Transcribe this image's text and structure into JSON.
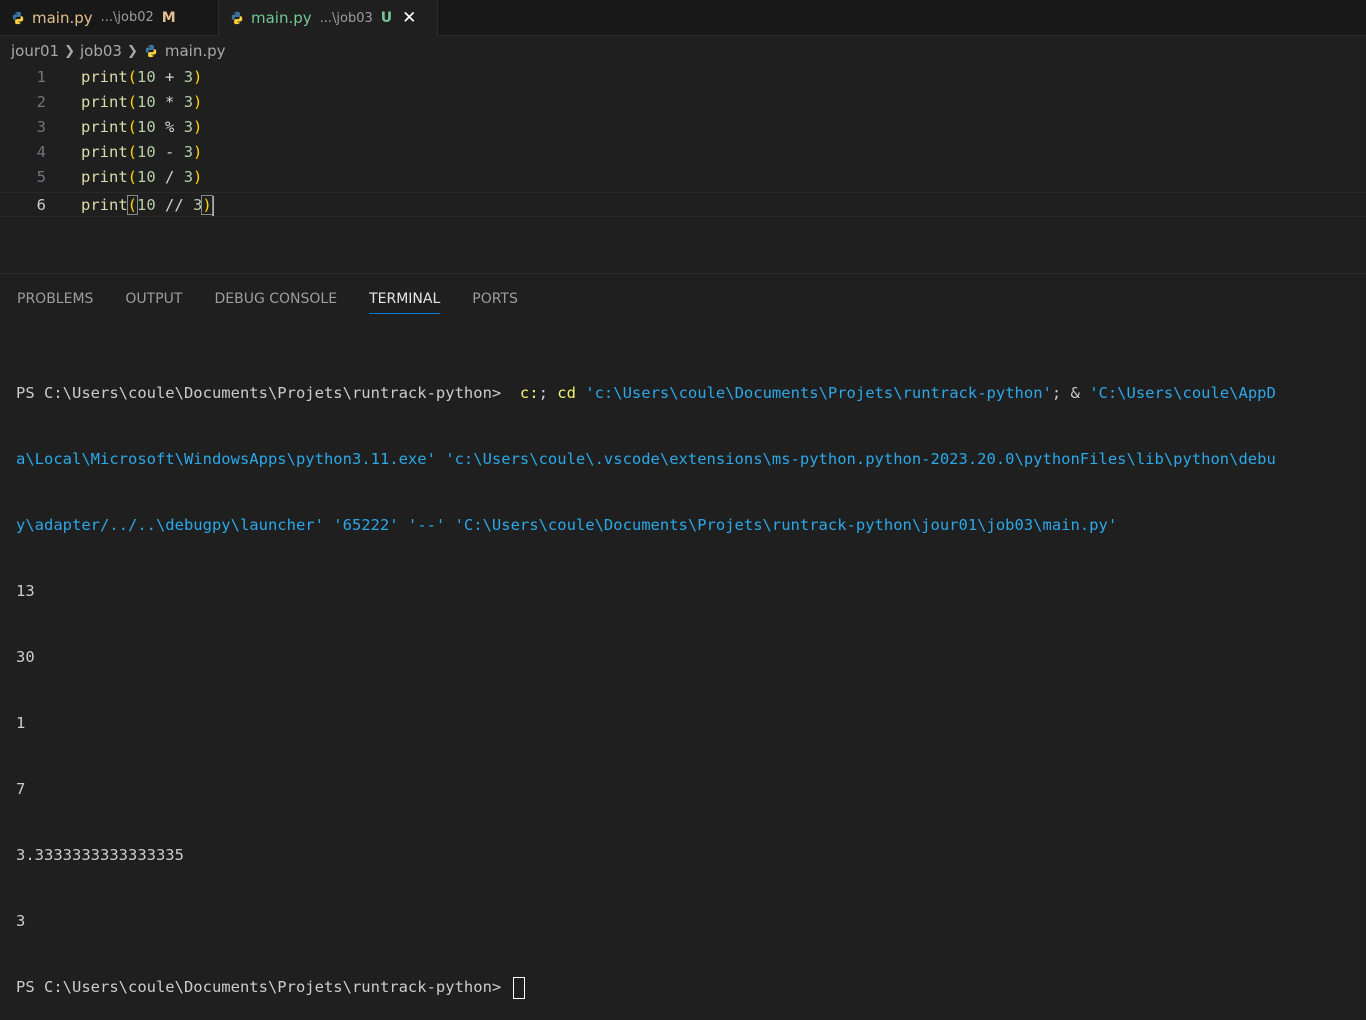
{
  "tabs": [
    {
      "name": "main.py",
      "dir": "...\\job02",
      "status": "M",
      "icon": "python-icon"
    },
    {
      "name": "main.py",
      "dir": "...\\job03",
      "status": "U",
      "icon": "python-icon",
      "close": "✕"
    }
  ],
  "breadcrumb": {
    "items": [
      "jour01",
      "job03",
      "main.py"
    ]
  },
  "editor": {
    "lines": [
      {
        "num": "1",
        "fn": "print",
        "open": "(",
        "a": "10",
        "op": " + ",
        "b": "3",
        "close": ")"
      },
      {
        "num": "2",
        "fn": "print",
        "open": "(",
        "a": "10",
        "op": " * ",
        "b": "3",
        "close": ")"
      },
      {
        "num": "3",
        "fn": "print",
        "open": "(",
        "a": "10",
        "op": " % ",
        "b": "3",
        "close": ")"
      },
      {
        "num": "4",
        "fn": "print",
        "open": "(",
        "a": "10",
        "op": " - ",
        "b": "3",
        "close": ")"
      },
      {
        "num": "5",
        "fn": "print",
        "open": "(",
        "a": "10",
        "op": " / ",
        "b": "3",
        "close": ")"
      },
      {
        "num": "6",
        "fn": "print",
        "open": "(",
        "a": "10",
        "op": " // ",
        "b": "3",
        "close": ")"
      }
    ]
  },
  "panel": {
    "tabs": [
      "PROBLEMS",
      "OUTPUT",
      "DEBUG CONSOLE",
      "TERMINAL",
      "PORTS"
    ],
    "active": "TERMINAL"
  },
  "terminal": {
    "prompt": "PS C:\\Users\\coule\\Documents\\Projets\\runtrack-python> ",
    "cmd1": " c:",
    "sep1": "; ",
    "cmd2": "cd",
    "arg1": " 'c:\\Users\\coule\\Documents\\Projets\\runtrack-python'",
    "sep2": "; & ",
    "arg2": "'C:\\Users\\coule\\AppD",
    "wrap1": "a\\Local\\Microsoft\\WindowsApps\\python3.11.exe' 'c:\\Users\\coule\\.vscode\\extensions\\ms-python.python-2023.20.0\\pythonFiles\\lib\\python\\debu",
    "wrap2": "y\\adapter/../..\\debugpy\\launcher' '65222' '--' 'C:\\Users\\coule\\Documents\\Projets\\runtrack-python\\jour01\\job03\\main.py'",
    "output": [
      "13",
      "30",
      "1",
      "7",
      "3.3333333333333335",
      "3"
    ],
    "final_prompt": "PS C:\\Users\\coule\\Documents\\Projets\\runtrack-python>"
  },
  "colors": {
    "modified": "#e2c08d",
    "untracked": "#73c991",
    "accent": "#0078d4"
  }
}
